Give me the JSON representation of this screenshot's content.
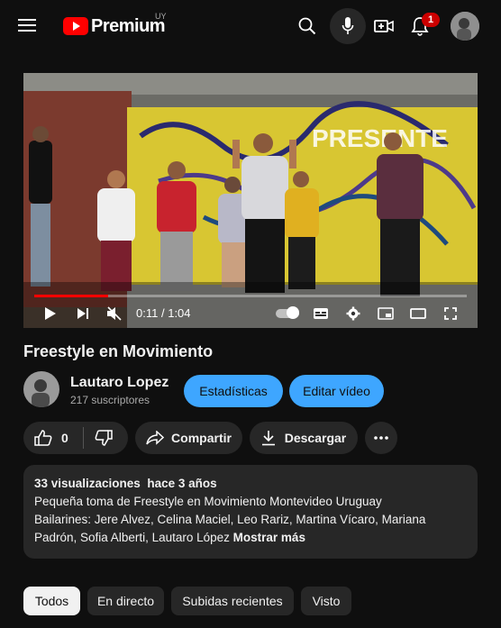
{
  "topbar": {
    "logo_text": "Premium",
    "logo_region": "UY",
    "notifications_count": "1"
  },
  "video": {
    "time_current": "0:11",
    "time_separator": "/",
    "time_total": "1:04",
    "progress_fraction": 0.17,
    "graffiti_text": "PRESENTE"
  },
  "info": {
    "title": "Freestyle en Movimiento",
    "channel_name": "Lautaro Lopez",
    "subscribers": "217 suscriptores",
    "stats_button": "Estadísticas",
    "edit_button": "Editar vídeo",
    "likes": "0",
    "share_label": "Compartir",
    "download_label": "Descargar"
  },
  "description": {
    "views": "33 visualizaciones",
    "age": "hace 3 años",
    "line1": "Pequeña toma de Freestyle en Movimiento Montevideo Uruguay",
    "line2": "Bailarines: Jere Alvez, Celina Maciel, Leo Rariz, Martina Vícaro, Mariana",
    "line3": "Padrón, Sofia Alberti, Lautaro López",
    "more": "Mostrar más"
  },
  "chips": [
    "Todos",
    "En directo",
    "Subidas recientes",
    "Visto"
  ],
  "colors": {
    "background": "#0f0f0f",
    "accent_blue": "#3ea6ff",
    "brand_red": "#ff0000",
    "progress_red": "#ff0000",
    "surface": "#272727"
  }
}
